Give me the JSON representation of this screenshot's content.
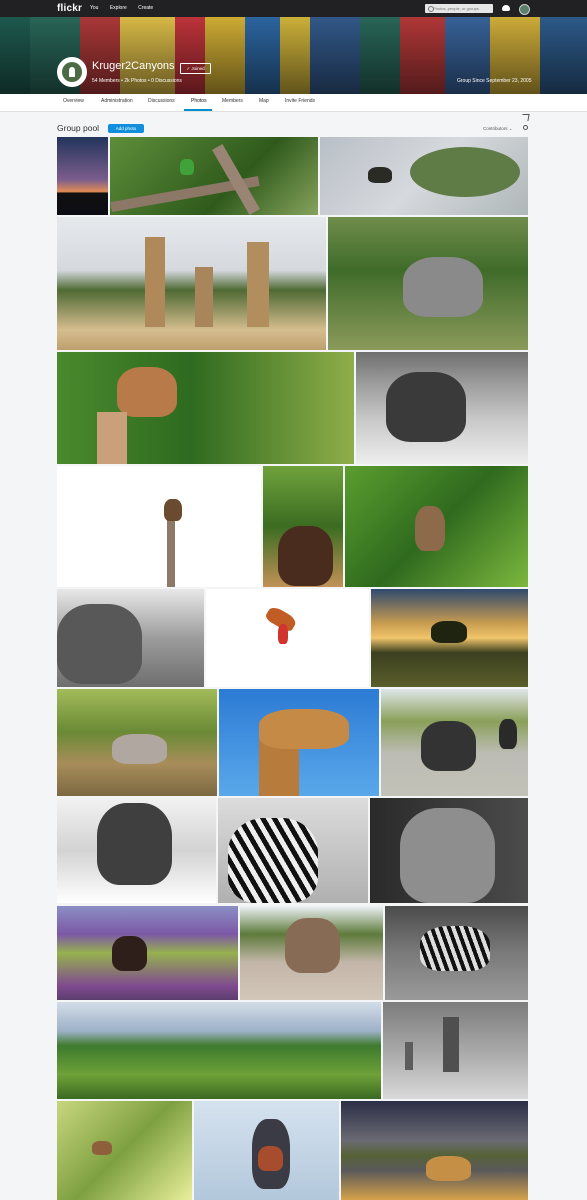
{
  "topbar": {
    "logo": "flickr",
    "nav": [
      "You",
      "Explore",
      "Create"
    ],
    "search_placeholder": "Photos, people, or groups"
  },
  "group": {
    "name": "Kruger2Canyons",
    "joined_label": "✓ Joined",
    "stats": "54 Members  •  2k Photos  •  0 Discussions",
    "since": "Group Since September 23, 2005"
  },
  "tabs": [
    "Overview",
    "Administration",
    "Discussions",
    "Photos",
    "Members",
    "Map",
    "Invite Friends"
  ],
  "active_tab": "Photos",
  "pool": {
    "title": "Group pool",
    "add_photo_label": "Add photo",
    "sort_label": "Contributors ⌄"
  },
  "photos": [
    {
      "subject": "sunset over lake"
    },
    {
      "subject": "bee-eater bird on branch"
    },
    {
      "subject": "spider on leaves"
    },
    {
      "subject": "three giraffes"
    },
    {
      "subject": "rhino grazing"
    },
    {
      "subject": "impala"
    },
    {
      "subject": "elephant (black and white)"
    },
    {
      "subject": "raptor on dead tree"
    },
    {
      "subject": "sable antelope"
    },
    {
      "subject": "monkey in tree"
    },
    {
      "subject": "elephant (black and white)"
    },
    {
      "subject": "sunbird in flight"
    },
    {
      "subject": "savanna sunset"
    },
    {
      "subject": "dove in grass"
    },
    {
      "subject": "giraffe against blue sky"
    },
    {
      "subject": "elephants on road"
    },
    {
      "subject": "elephant (black and white)"
    },
    {
      "subject": "zebra (black and white)"
    },
    {
      "subject": "lioness (black and white)"
    },
    {
      "subject": "buffalo and birds"
    },
    {
      "subject": "elephant on road"
    },
    {
      "subject": "zebra foal"
    },
    {
      "subject": "green hills landscape"
    },
    {
      "subject": "giraffes (black and white)"
    },
    {
      "subject": "small bird on branch"
    },
    {
      "subject": "kingfisher"
    },
    {
      "subject": "lions on road"
    }
  ]
}
